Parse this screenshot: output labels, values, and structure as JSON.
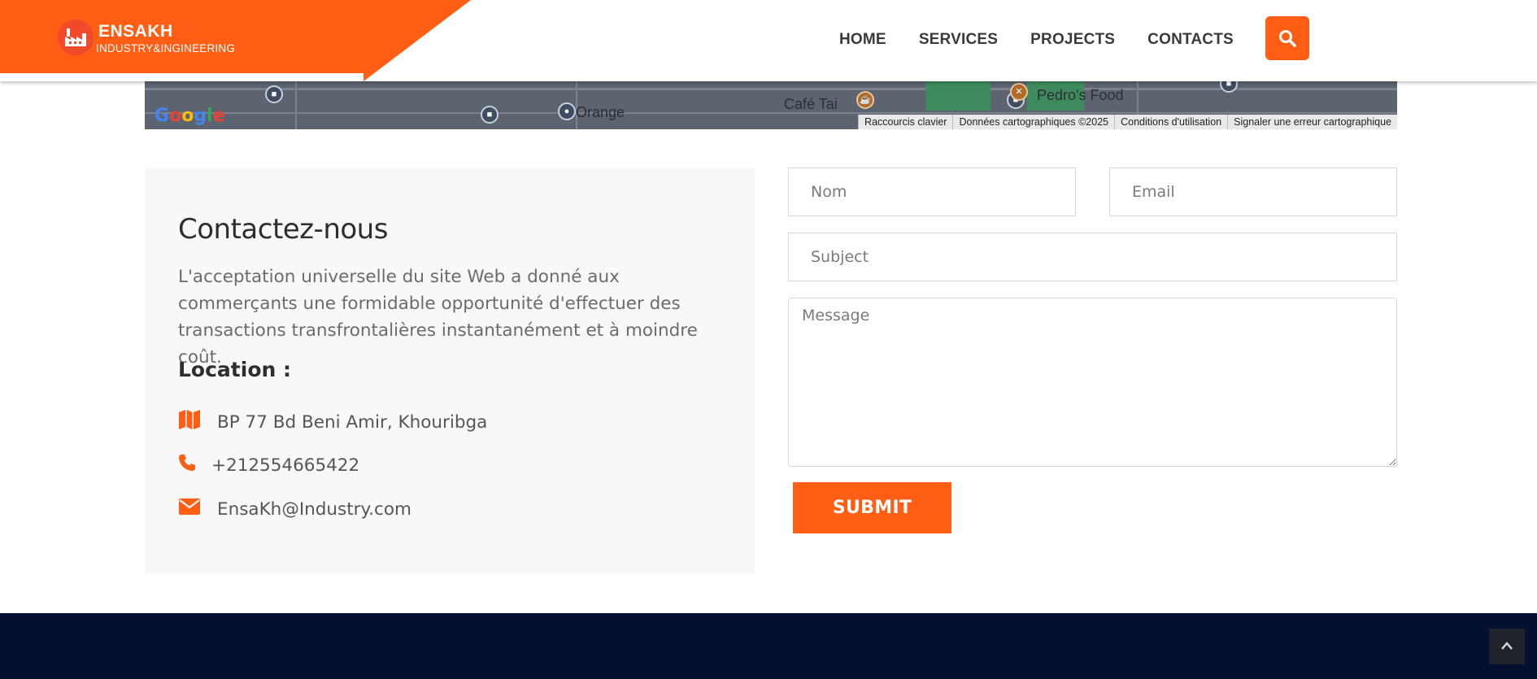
{
  "brand": {
    "title": "ENSAKH",
    "subtitle": "INDUSTRY&INGINEERING",
    "accent_color": "#ff5e14",
    "icon": "factory-icon"
  },
  "nav": {
    "items": [
      {
        "label": "HOME"
      },
      {
        "label": "SERVICES"
      },
      {
        "label": "PROJECTS"
      },
      {
        "label": "CONTACTS"
      }
    ],
    "search_icon": "search-icon"
  },
  "map": {
    "labels": [
      "Café Tai",
      "Pedro's Food",
      "Orange"
    ],
    "logo": "Google",
    "attribution": [
      "Raccourcis clavier",
      "Données cartographiques ©2025",
      "Conditions d'utilisation",
      "Signaler une erreur cartographique"
    ]
  },
  "contact": {
    "heading": "Contactez-nous",
    "description": "L'acceptation universelle du site Web a donné aux commerçants une formidable opportunité d'effectuer des transactions transfrontalières instantanément et à moindre coût.",
    "location_heading": "Location :",
    "address": "BP 77 Bd Beni Amir, Khouribga",
    "phone": "+212554665422",
    "email": "EnsaKh@Industry.com",
    "icons": [
      "map-icon",
      "phone-icon",
      "envelope-icon"
    ]
  },
  "form": {
    "name_placeholder": "Nom",
    "email_placeholder": "Email",
    "subject_placeholder": "Subject",
    "message_placeholder": "Message",
    "submit_label": "SUBMIT"
  },
  "footer": {
    "background": "#050f2f",
    "back_to_top_icon": "chevron-up-icon"
  }
}
